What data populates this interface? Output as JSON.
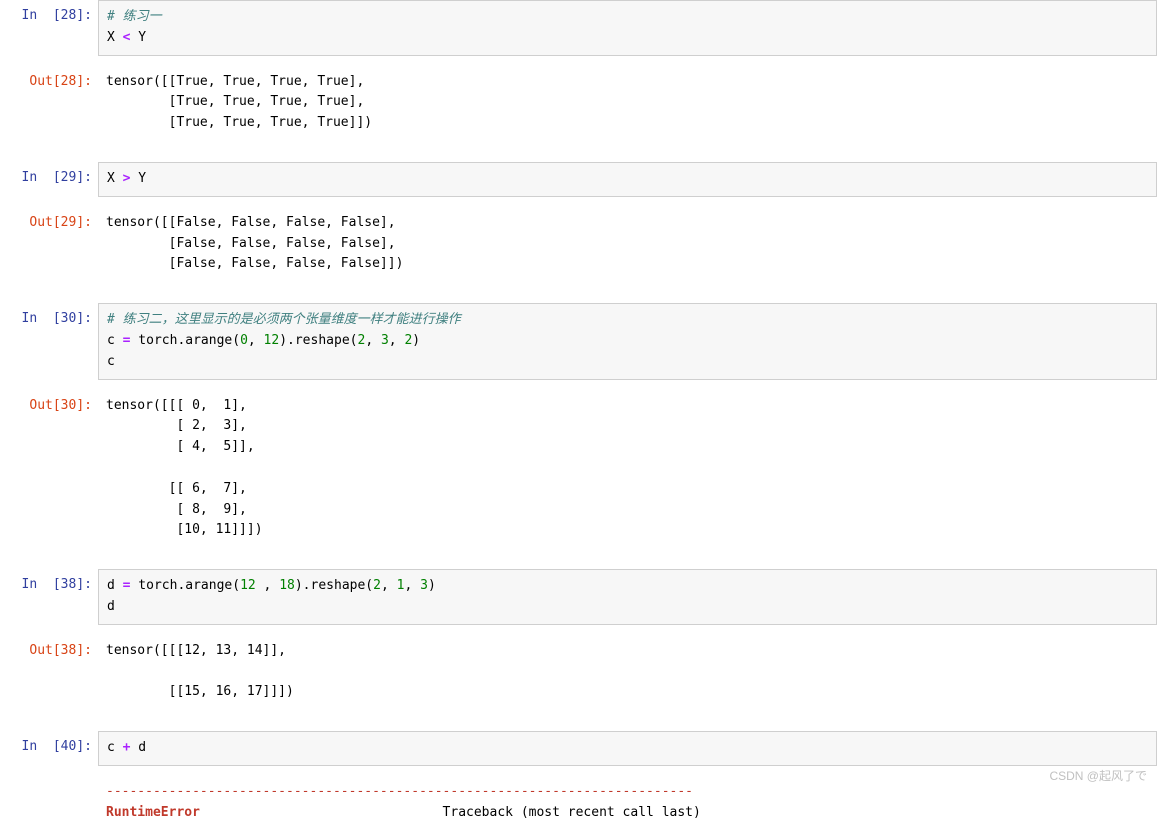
{
  "cells": [
    {
      "type": "in",
      "n": "28",
      "prompt_in": "In  [28]:",
      "lines": [
        {
          "segs": [
            {
              "t": "# 练习一",
              "cls": "c-comment"
            }
          ]
        },
        {
          "segs": [
            {
              "t": "X "
            },
            {
              "t": "<",
              "cls": "c-op"
            },
            {
              "t": " Y"
            }
          ]
        }
      ]
    },
    {
      "type": "out",
      "n": "28",
      "prompt_out": "Out[28]:",
      "text": "tensor([[True, True, True, True],\n        [True, True, True, True],\n        [True, True, True, True]])"
    },
    {
      "type": "in",
      "n": "29",
      "prompt_in": "In  [29]:",
      "lines": [
        {
          "segs": [
            {
              "t": "X "
            },
            {
              "t": ">",
              "cls": "c-op"
            },
            {
              "t": " Y"
            }
          ]
        }
      ]
    },
    {
      "type": "out",
      "n": "29",
      "prompt_out": "Out[29]:",
      "text": "tensor([[False, False, False, False],\n        [False, False, False, False],\n        [False, False, False, False]])"
    },
    {
      "type": "in",
      "n": "30",
      "prompt_in": "In  [30]:",
      "lines": [
        {
          "segs": [
            {
              "t": "# 练习二，这里显示的是必须两个张量维度一样才能进行操作",
              "cls": "c-comment"
            }
          ]
        },
        {
          "segs": [
            {
              "t": "c "
            },
            {
              "t": "=",
              "cls": "c-op"
            },
            {
              "t": " torch.arange("
            },
            {
              "t": "0",
              "cls": "c-num"
            },
            {
              "t": ", "
            },
            {
              "t": "12",
              "cls": "c-num"
            },
            {
              "t": ").reshape("
            },
            {
              "t": "2",
              "cls": "c-num"
            },
            {
              "t": ", "
            },
            {
              "t": "3",
              "cls": "c-num"
            },
            {
              "t": ", "
            },
            {
              "t": "2",
              "cls": "c-num"
            },
            {
              "t": ")"
            }
          ]
        },
        {
          "segs": [
            {
              "t": "c"
            }
          ]
        }
      ]
    },
    {
      "type": "out",
      "n": "30",
      "prompt_out": "Out[30]:",
      "text": "tensor([[[ 0,  1],\n         [ 2,  3],\n         [ 4,  5]],\n\n        [[ 6,  7],\n         [ 8,  9],\n         [10, 11]]])"
    },
    {
      "type": "in",
      "n": "38",
      "prompt_in": "In  [38]:",
      "lines": [
        {
          "segs": [
            {
              "t": "d "
            },
            {
              "t": "=",
              "cls": "c-op"
            },
            {
              "t": " torch.arange("
            },
            {
              "t": "12",
              "cls": "c-num"
            },
            {
              "t": " , "
            },
            {
              "t": "18",
              "cls": "c-num"
            },
            {
              "t": ").reshape("
            },
            {
              "t": "2",
              "cls": "c-num"
            },
            {
              "t": ", "
            },
            {
              "t": "1",
              "cls": "c-num"
            },
            {
              "t": ", "
            },
            {
              "t": "3",
              "cls": "c-num"
            },
            {
              "t": ")"
            }
          ]
        },
        {
          "segs": [
            {
              "t": "d"
            }
          ]
        }
      ]
    },
    {
      "type": "out",
      "n": "38",
      "prompt_out": "Out[38]:",
      "text": "tensor([[[12, 13, 14]],\n\n        [[15, 16, 17]]])"
    },
    {
      "type": "in",
      "n": "40",
      "prompt_in": "In  [40]:",
      "lines": [
        {
          "segs": [
            {
              "t": "c "
            },
            {
              "t": "+",
              "cls": "c-op"
            },
            {
              "t": " d"
            }
          ]
        }
      ]
    },
    {
      "type": "err",
      "sep": "---------------------------------------------------------------------------",
      "err_name": "RuntimeError",
      "trace": "                               Traceback (most recent call last)"
    }
  ],
  "watermark": "CSDN @起风了で"
}
